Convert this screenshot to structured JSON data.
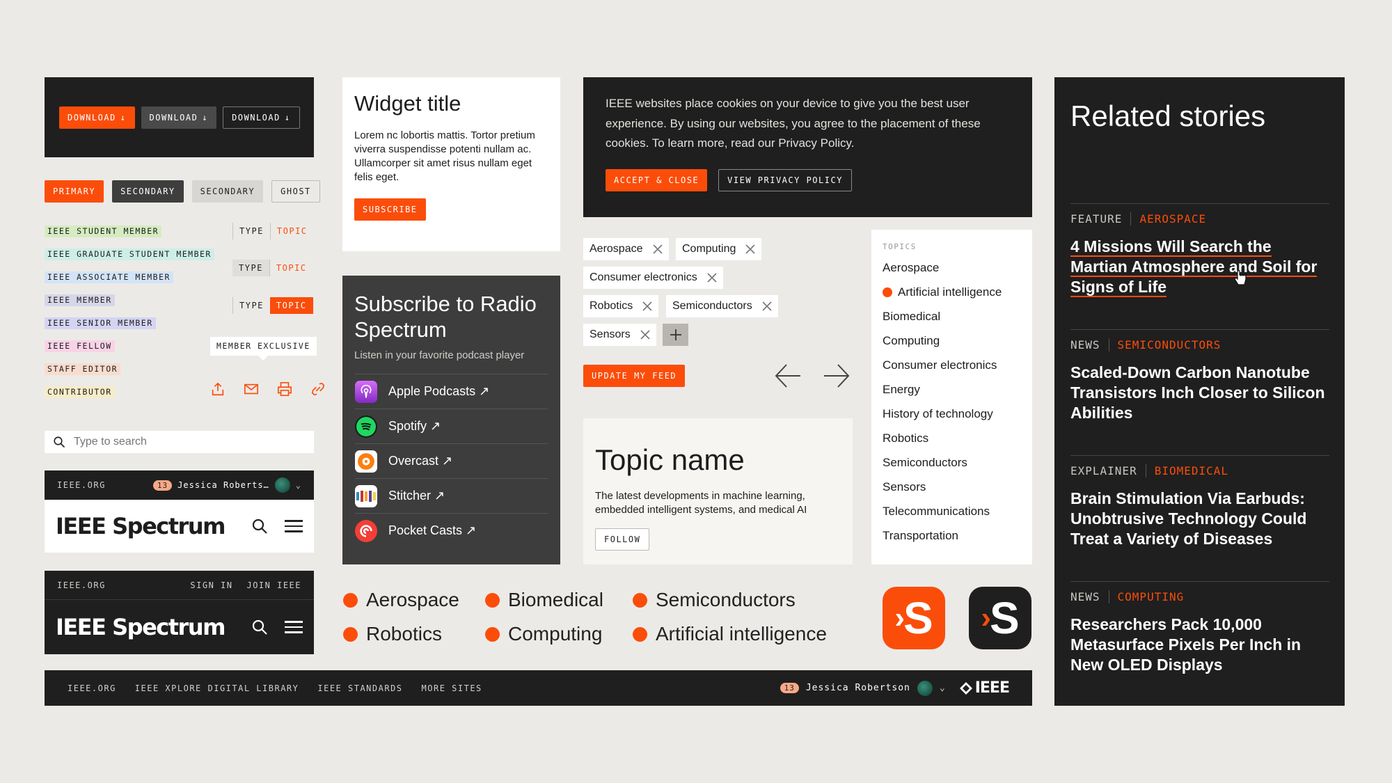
{
  "download_buttons": [
    "DOWNLOAD",
    "DOWNLOAD",
    "DOWNLOAD"
  ],
  "button_row": [
    "PRIMARY",
    "SECONDARY",
    "SECONDARY",
    "GHOST"
  ],
  "member_chips": [
    {
      "label": "IEEE STUDENT MEMBER",
      "color": "#d4ecc0"
    },
    {
      "label": "IEEE GRADUATE STUDENT MEMBER",
      "color": "#cdeee7"
    },
    {
      "label": "IEEE ASSOCIATE MEMBER",
      "color": "#d3e4f6"
    },
    {
      "label": "IEEE MEMBER",
      "color": "#d6d6e9"
    },
    {
      "label": "IEEE SENIOR MEMBER",
      "color": "#d4d4f3"
    },
    {
      "label": "IEEE FELLOW",
      "color": "#f8d3e6"
    },
    {
      "label": "STAFF EDITOR",
      "color": "#f9dccd"
    },
    {
      "label": "CONTRIBUTOR",
      "color": "#f6ecc7"
    }
  ],
  "type_topic": {
    "type": "TYPE",
    "topic": "TOPIC"
  },
  "member_exclusive": "MEMBER EXCLUSIVE",
  "search": {
    "placeholder": "Type to search"
  },
  "header1": {
    "site": "IEEE.ORG",
    "count": "13",
    "user": "Jessica Roberts…",
    "logo": "IEEE Spectrum"
  },
  "header2": {
    "site": "IEEE.ORG",
    "sign_in": "SIGN IN",
    "join": "JOIN IEEE",
    "logo": "IEEE Spectrum"
  },
  "widget": {
    "title": "Widget title",
    "body": "Lorem nc lobortis mattis. Tortor pretium viverra suspendisse potenti nullam ac. Ullamcorper sit amet risus nullam eget felis eget.",
    "button": "SUBSCRIBE"
  },
  "podcast": {
    "title": "Subscribe to Radio Spectrum",
    "subtitle": "Listen in your favorite podcast player",
    "players": [
      {
        "name": "Apple Podcasts ↗",
        "icon": "apple-podcasts-icon"
      },
      {
        "name": "Spotify ↗",
        "icon": "spotify-icon"
      },
      {
        "name": "Overcast ↗",
        "icon": "overcast-icon"
      },
      {
        "name": "Stitcher ↗",
        "icon": "stitcher-icon"
      },
      {
        "name": "Pocket Casts ↗",
        "icon": "pocket-casts-icon"
      }
    ]
  },
  "cookie": {
    "text": "IEEE websites place cookies on your device to give you the best user experience. By using our websites, you agree to the placement of these cookies. To learn more, read our Privacy Policy.",
    "accept": "ACCEPT & CLOSE",
    "privacy": "VIEW PRIVACY POLICY"
  },
  "tags": [
    "Aerospace",
    "Computing",
    "Consumer electronics",
    "Robotics",
    "Semiconductors",
    "Sensors"
  ],
  "update_feed": "UPDATE MY FEED",
  "topic_card": {
    "title": "Topic name",
    "description": "The latest developments in machine learning, embedded intelligent systems, and medical AI",
    "button": "FOLLOW"
  },
  "topics_list": {
    "heading": "TOPICS",
    "items": [
      "Aerospace",
      "Artificial intelligence",
      "Biomedical",
      "Computing",
      "Consumer electronics",
      "Energy",
      "History of technology",
      "Robotics",
      "Semiconductors",
      "Sensors",
      "Telecommunications",
      "Transportation"
    ]
  },
  "big_topics": [
    "Aerospace",
    "Biomedical",
    "Semiconductors",
    "Robotics",
    "Computing",
    "Artificial intelligence"
  ],
  "related": {
    "title": "Related stories",
    "stories": [
      {
        "type": "FEATURE",
        "topic": "AEROSPACE",
        "headline": "4 Missions Will Search the Martian Atmosphere and Soil for Signs of Life"
      },
      {
        "type": "NEWS",
        "topic": "SEMICONDUCTORS",
        "headline": "Scaled-Down Carbon Nanotube Transistors Inch Closer to Silicon Abilities"
      },
      {
        "type": "EXPLAINER",
        "topic": "BIOMEDICAL",
        "headline": "Brain Stimulation Via Earbuds: Unobtrusive Technology Could Treat a Variety of Diseases"
      },
      {
        "type": "NEWS",
        "topic": "COMPUTING",
        "headline": "Researchers Pack 10,000 Metasurface Pixels Per Inch in New OLED Displays"
      }
    ]
  },
  "footer": {
    "links": [
      "IEEE.ORG",
      "IEEE XPLORE DIGITAL LIBRARY",
      "IEEE STANDARDS",
      "MORE SITES"
    ],
    "count": "13",
    "user": "Jessica Robertson",
    "logo": "IEEE"
  },
  "app_icon_letter": "S",
  "colors": {
    "accent": "#fb4d0a",
    "dark": "#1f1f1f"
  }
}
